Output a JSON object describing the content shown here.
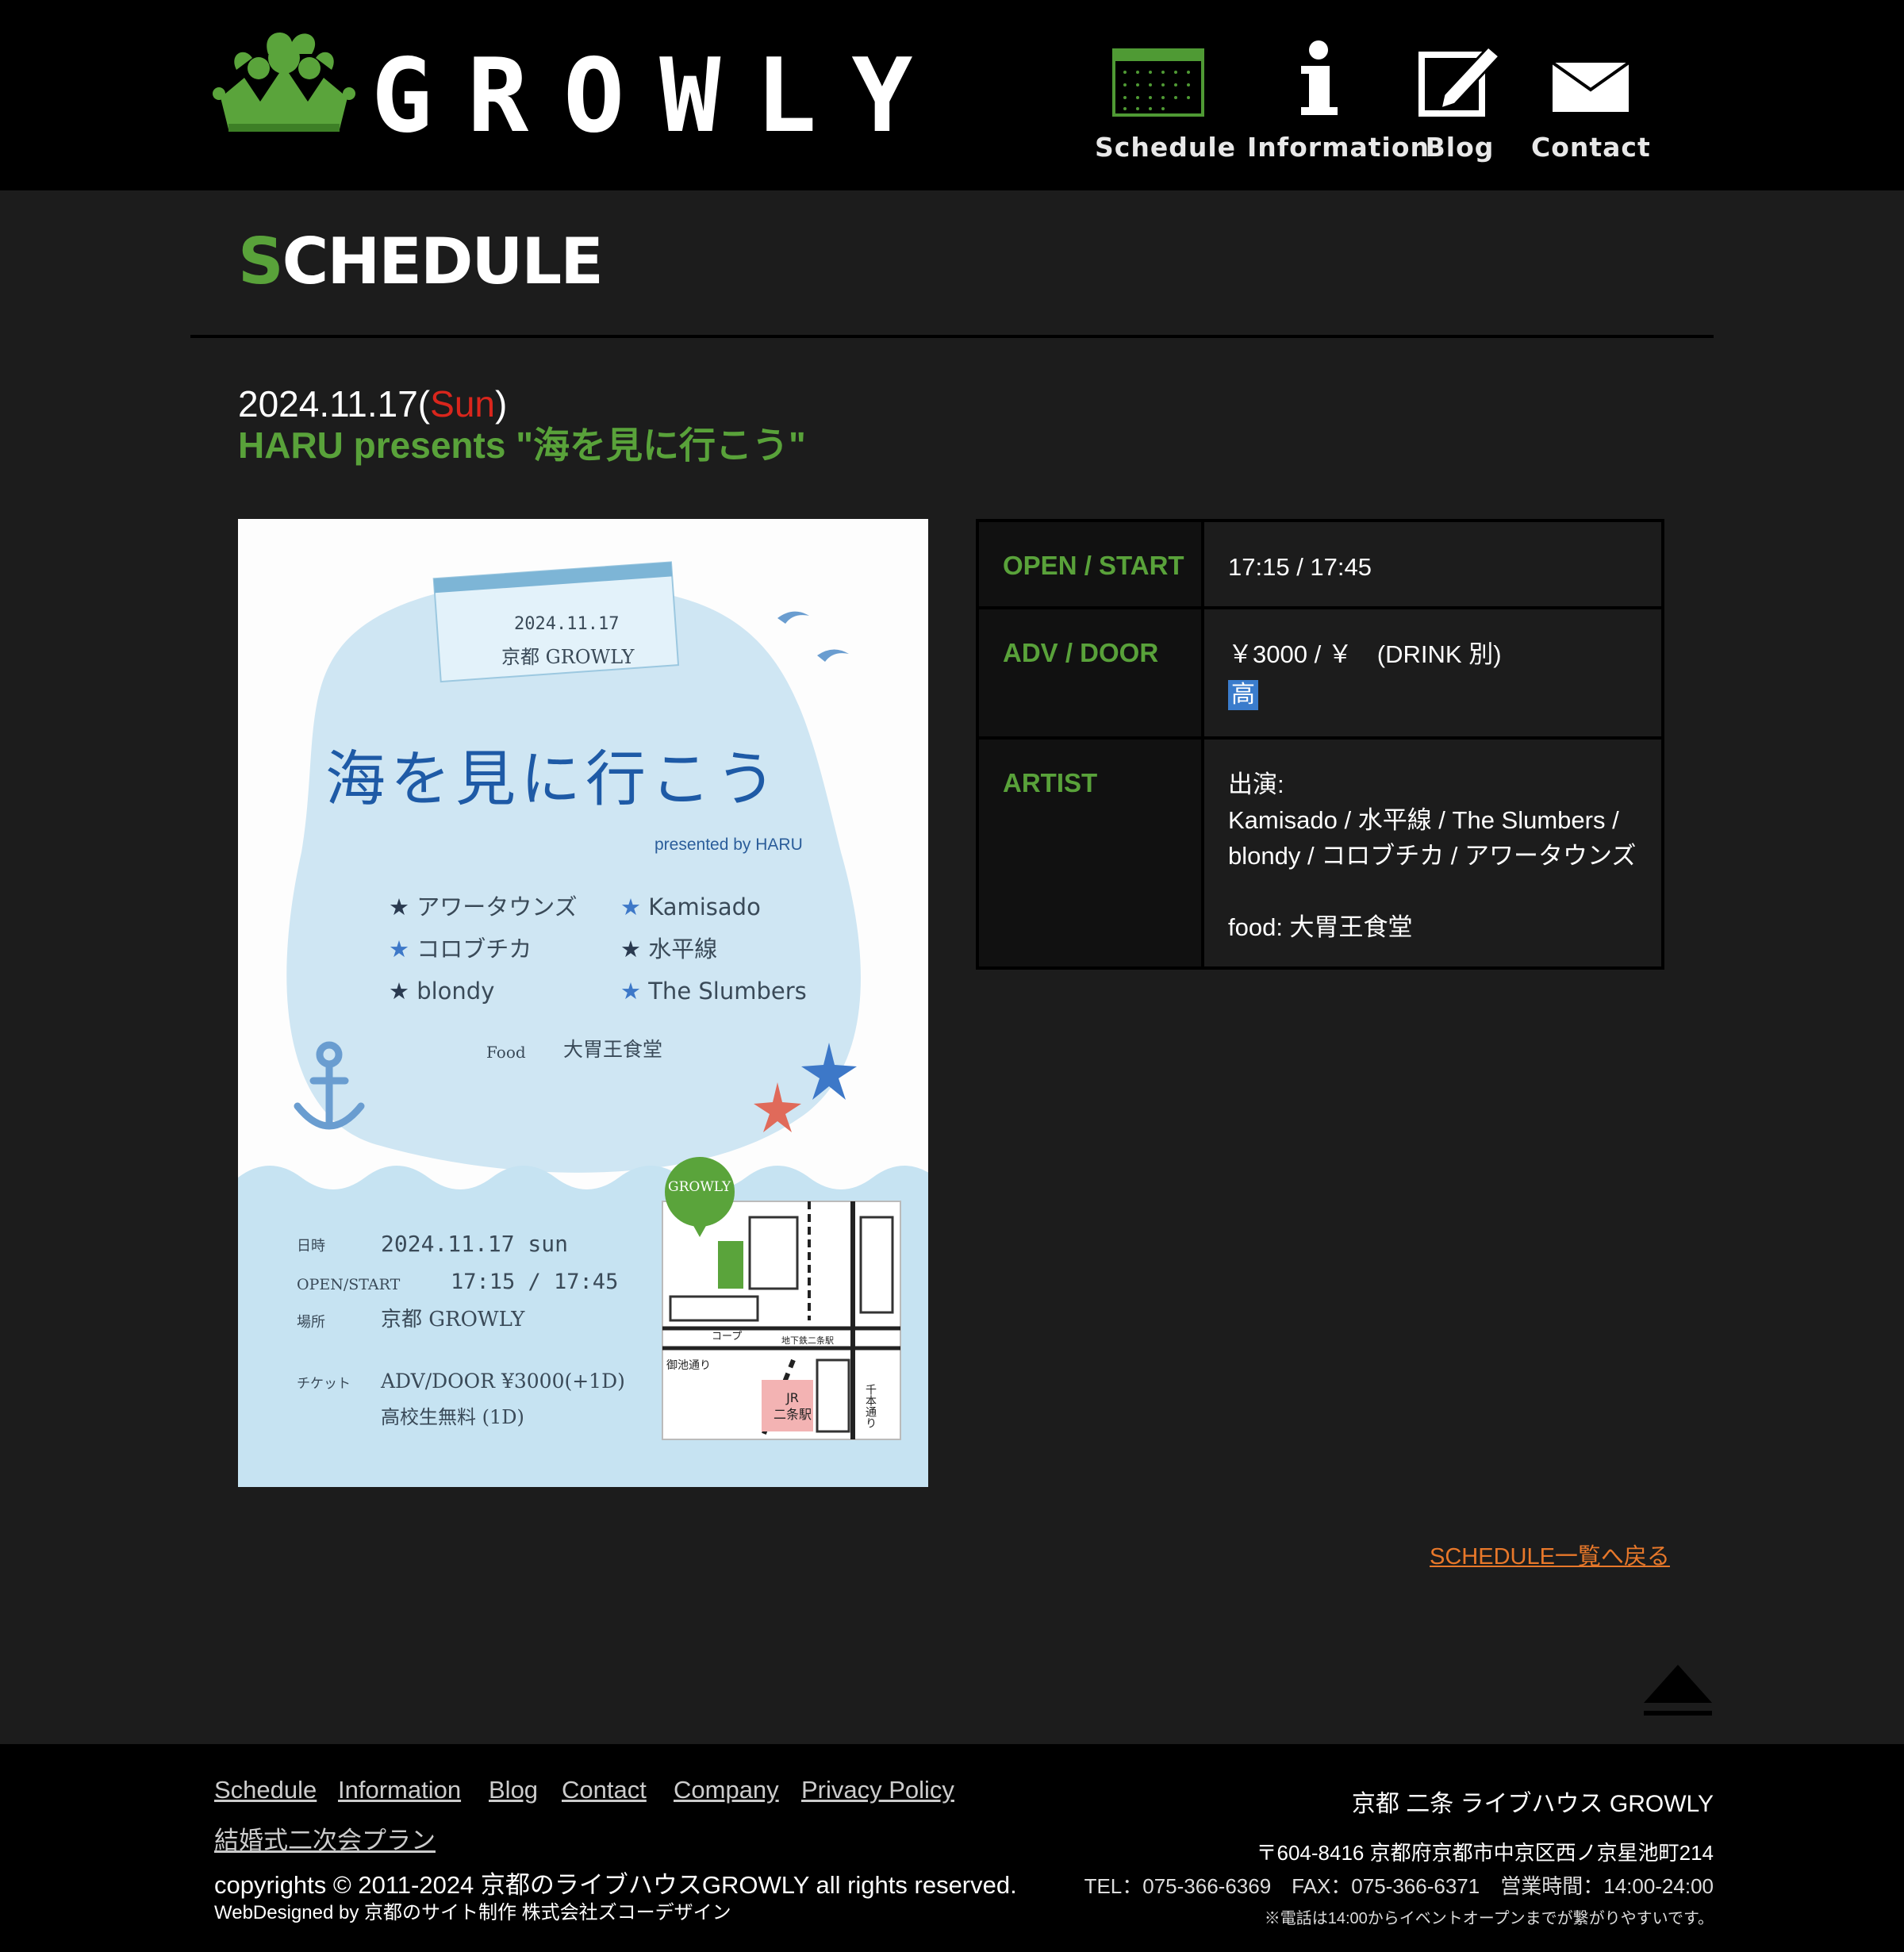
{
  "header": {
    "logo_text": "GROWLY",
    "nav": [
      {
        "label": "Schedule",
        "icon": "calendar-icon"
      },
      {
        "label": "Information",
        "icon": "info-icon"
      },
      {
        "label": "Blog",
        "icon": "pencil-note-icon"
      },
      {
        "label": "Contact",
        "icon": "envelope-icon"
      }
    ]
  },
  "page": {
    "heading_first": "S",
    "heading_rest": "CHEDULE"
  },
  "event": {
    "date": "2024.11.17(",
    "dow": "Sun",
    "date_close": ")",
    "title": "HARU presents \"海を見に行こう\""
  },
  "flyer": {
    "tag_date": "2024.11.17",
    "tag_venue": "京都 GROWLY",
    "title": "海を見に行こう",
    "presented": "presented by HARU",
    "artists_left": [
      "アワータウンズ",
      "コロブチカ",
      "blondy"
    ],
    "artists_right": [
      "Kamisado",
      "水平線",
      "The Slumbers"
    ],
    "food_label": "Food",
    "food_name": "大胃王食堂",
    "map_badge": "GROWLY",
    "details": [
      {
        "label": "日時",
        "value": "2024.11.17 sun"
      },
      {
        "label": "OPEN/START",
        "value": "17:15 / 17:45"
      },
      {
        "label": "場所",
        "value": "京都 GROWLY"
      },
      {
        "label": "チケット",
        "value": "ADV/DOOR ¥3000(+1D)"
      },
      {
        "label": "",
        "value": "高校生無料 (1D)"
      }
    ],
    "map_labels": {
      "station": "JR\n二条駅",
      "street1": "御池通り",
      "street2": "千本通り",
      "coop": "コープ",
      "subway": "地下鉄二条駅"
    }
  },
  "info": {
    "open_label": "OPEN / START",
    "open_value": "17:15 / 17:45",
    "adv_label": "ADV / DOOR",
    "adv_value": "￥3000 / ￥　(DRINK 別)",
    "adv_badge": "高",
    "artist_label": "ARTIST",
    "artist_line1": "出演:",
    "artist_line2": "Kamisado / 水平線 / The Slumbers /",
    "artist_line3": "blondy / コロブチカ / アワータウンズ",
    "artist_food": "food: 大胃王食堂"
  },
  "back_link": "SCHEDULE一覧へ戻る",
  "footer": {
    "links": [
      "Schedule",
      "Information",
      "Blog",
      "Contact",
      "Company",
      "Privacy Policy"
    ],
    "link_wedding": "結婚式二次会プラン",
    "copyright": "copyrights © 2011-2024 京都のライブハウスGROWLY all rights reserved.",
    "webdesigned": "WebDesigned by 京都のサイト制作 株式会社ズコーデザイン",
    "venue_name": "京都 二条 ライブハウス GROWLY",
    "address": "〒604-8416 京都府京都市中京区西ノ京星池町214",
    "tel": "TEL：075-366-6369　FAX：075-366-6371　営業時間：14:00-24:00",
    "note": "※電話は14:00からイベントオープンまでが繋がりやすいです。"
  },
  "colors": {
    "accent_green": "#59a23a",
    "sunday_red": "#d9261c",
    "link_orange": "#e8782a",
    "background": "#1c1c1c",
    "badge_blue": "#3a7ccc"
  }
}
